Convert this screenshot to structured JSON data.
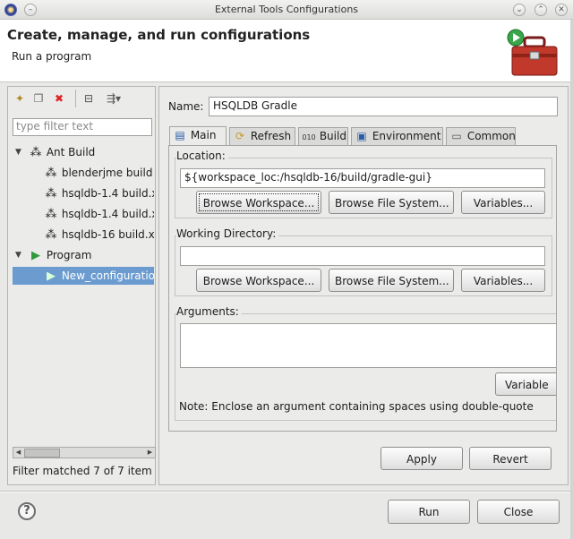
{
  "window": {
    "title": "External Tools Configurations"
  },
  "header": {
    "title": "Create, manage, and run configurations",
    "subtitle": "Run a program"
  },
  "left": {
    "filter_placeholder": "type filter text",
    "tree": [
      {
        "label": "Ant Build",
        "icon": "ant-icon",
        "level": 0,
        "expanded": true
      },
      {
        "label": "blenderjme build",
        "icon": "ant-icon",
        "level": 1
      },
      {
        "label": "hsqldb-1.4 build.x",
        "icon": "ant-icon",
        "level": 1
      },
      {
        "label": "hsqldb-1.4 build.x",
        "icon": "ant-icon",
        "level": 1
      },
      {
        "label": "hsqldb-16 build.x",
        "icon": "ant-icon",
        "level": 1
      },
      {
        "label": "Program",
        "icon": "program-icon",
        "level": 0,
        "expanded": true
      },
      {
        "label": "New_configuratio",
        "icon": "program-config-icon",
        "level": 1,
        "selected": true
      }
    ],
    "status": "Filter matched 7 of 7 item"
  },
  "main": {
    "name_label": "Name:",
    "name_value": "HSQLDB Gradle",
    "tabs": [
      {
        "label": "Main",
        "icon": "main-tab-icon",
        "active": true
      },
      {
        "label": "Refresh",
        "icon": "refresh-icon"
      },
      {
        "label": "Build",
        "icon": "build-icon"
      },
      {
        "label": "Environment",
        "icon": "environment-icon"
      },
      {
        "label": "Common",
        "icon": "common-icon"
      }
    ],
    "location": {
      "label": "Location:",
      "value": "${workspace_loc:/hsqldb-16/build/gradle-gui}",
      "browse_workspace": "Browse Workspace...",
      "browse_fs": "Browse File System...",
      "variables": "Variables..."
    },
    "working_dir": {
      "label": "Working Directory:",
      "value": "",
      "browse_workspace": "Browse Workspace...",
      "browse_fs": "Browse File System...",
      "variables": "Variables..."
    },
    "arguments": {
      "label": "Arguments:",
      "value": "",
      "variables": "Variable",
      "note": "Note: Enclose an argument containing spaces using double-quote"
    },
    "apply": "Apply",
    "revert": "Revert"
  },
  "footer": {
    "run": "Run",
    "close": "Close",
    "help_icon": "help-icon"
  },
  "colors": {
    "selection": "#6b9bcf",
    "dialog_bg": "#e8e8e7"
  }
}
